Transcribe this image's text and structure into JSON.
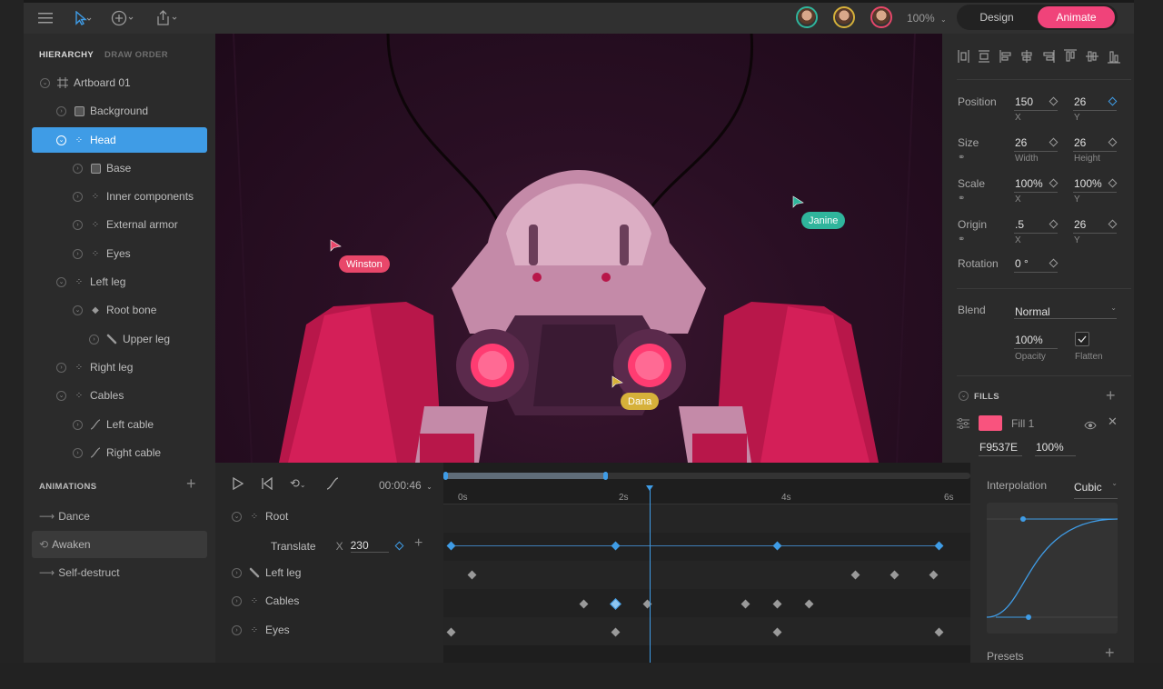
{
  "topbar": {
    "zoom": "100%",
    "mode_design": "Design",
    "mode_animate": "Animate"
  },
  "hierarchy": {
    "tab_hierarchy": "HIERARCHY",
    "tab_draw_order": "DRAW ORDER",
    "items": [
      {
        "label": "Artboard 01"
      },
      {
        "label": "Background"
      },
      {
        "label": "Head"
      },
      {
        "label": "Base"
      },
      {
        "label": "Inner components"
      },
      {
        "label": "External armor"
      },
      {
        "label": "Eyes"
      },
      {
        "label": "Left leg"
      },
      {
        "label": "Root bone"
      },
      {
        "label": "Upper leg"
      },
      {
        "label": "Right leg"
      },
      {
        "label": "Cables"
      },
      {
        "label": "Left cable"
      },
      {
        "label": "Right cable"
      }
    ]
  },
  "canvas": {
    "cursors": [
      {
        "name": "Winston",
        "color": "#e8476a"
      },
      {
        "name": "Janine",
        "color": "#2fb59c"
      },
      {
        "name": "Dana",
        "color": "#d6b13a"
      }
    ]
  },
  "properties": {
    "position_label": "Position",
    "position_x": "150",
    "position_y": "26",
    "size_label": "Size",
    "size_w": "26",
    "size_h": "26",
    "scale_label": "Scale",
    "scale_x": "100%",
    "scale_y": "100%",
    "origin_label": "Origin",
    "origin_x": ".5",
    "origin_y": "26",
    "rotation_label": "Rotation",
    "rotation": "0 °",
    "sub_x": "X",
    "sub_y": "Y",
    "sub_width": "Width",
    "sub_height": "Height",
    "blend_label": "Blend",
    "blend_value": "Normal",
    "opacity_value": "100%",
    "opacity_label": "Opacity",
    "flatten_label": "Flatten",
    "fills_label": "FILLS",
    "fill_name": "Fill 1",
    "fill_hex": "F9537E",
    "fill_opacity": "100%",
    "fill_color": "#f9537e"
  },
  "animations": {
    "title": "ANIMATIONS",
    "items": [
      {
        "label": "Dance"
      },
      {
        "label": "Awaken"
      },
      {
        "label": "Self-destruct"
      }
    ]
  },
  "timeline": {
    "time": "00:00:46",
    "ticks": [
      "0s",
      "2s",
      "4s",
      "6s"
    ],
    "rows": {
      "root": "Root",
      "translate": "Translate",
      "translate_axis": "X",
      "translate_value": "230",
      "left_leg": "Left leg",
      "cables": "Cables",
      "eyes": "Eyes"
    }
  },
  "interpolation": {
    "label": "Interpolation",
    "value": "Cubic",
    "presets": "Presets"
  },
  "colors": {
    "accent": "#3f9ce6",
    "animate": "#f0437a"
  }
}
